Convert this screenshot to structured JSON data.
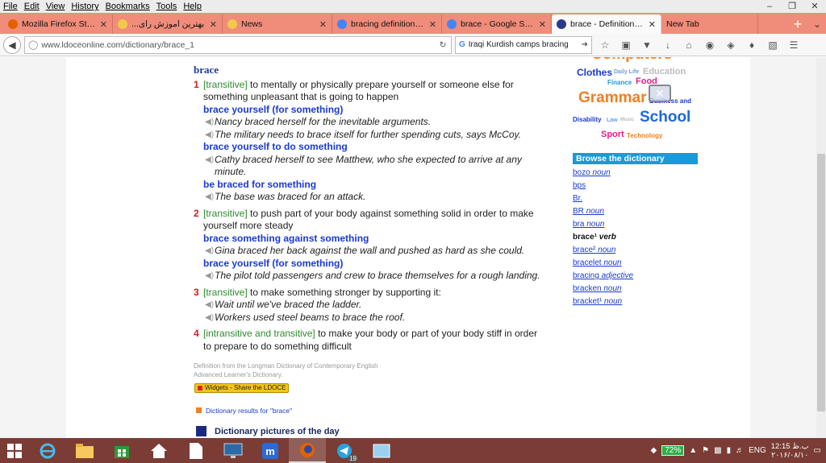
{
  "menu": [
    "File",
    "Edit",
    "View",
    "History",
    "Bookmarks",
    "Tools",
    "Help"
  ],
  "tabs": [
    {
      "label": "Mozilla Firefox Start P...",
      "icon_color": "#e66000",
      "active": false
    },
    {
      "label": "...بهترین آموزش رای",
      "icon_color": "#f2c94c",
      "active": false
    },
    {
      "label": "News",
      "icon_color": "#f2c94c",
      "active": false
    },
    {
      "label": "bracing definition - G...",
      "icon_color": "#4285f4",
      "active": false
    },
    {
      "label": "brace - Google Search",
      "icon_color": "#4285f4",
      "active": false
    },
    {
      "label": "brace - Definition fro...",
      "icon_color": "#2a3a8a",
      "active": true
    },
    {
      "label": "New Tab",
      "icon_color": "",
      "active": false
    }
  ],
  "nav": {
    "url": "www.ldoceonline.com/dictionary/brace_1",
    "search_value": "Iraqi Kurdish camps bracing"
  },
  "entry": {
    "headword": "brace",
    "senses": [
      {
        "num": "1",
        "gram": "[transitive]",
        "def": " to mentally or physically prepare yourself or someone else for something unpleasant that is going to happen",
        "items": [
          {
            "type": "phrase",
            "text": "brace yourself (for something)"
          },
          {
            "type": "example",
            "text": "Nancy braced herself for the inevitable arguments."
          },
          {
            "type": "example",
            "text": "The military needs to brace itself for further spending cuts, says McCoy."
          },
          {
            "type": "phrase",
            "text": "brace yourself to do something"
          },
          {
            "type": "example",
            "text": "Cathy braced herself to see Matthew, who she expected to arrive at any minute."
          },
          {
            "type": "phrase",
            "text": "be braced for something"
          },
          {
            "type": "example",
            "text": "The base was braced for an attack."
          }
        ]
      },
      {
        "num": "2",
        "gram": "[transitive]",
        "def": " to push part of your body against something solid in order to make yourself more steady",
        "items": [
          {
            "type": "phrase",
            "text": "brace something against something"
          },
          {
            "type": "example",
            "text": "Gina braced her back against the wall and pushed as hard as she could."
          },
          {
            "type": "phrase",
            "text": "brace yourself (for something)"
          },
          {
            "type": "example",
            "text": "The pilot told passengers and crew to brace themselves for a rough landing."
          }
        ]
      },
      {
        "num": "3",
        "gram": "[transitive]",
        "def": " to make something stronger by supporting it:",
        "items": [
          {
            "type": "example",
            "text": "Wait until we've braced the ladder."
          },
          {
            "type": "example",
            "text": "Workers used steel beams to brace the roof."
          }
        ]
      },
      {
        "num": "4",
        "gram": "[intransitive and transitive]",
        "def": " to make your body or part of your body stiff in order to prepare to do something difficult",
        "items": []
      }
    ]
  },
  "footer": {
    "attribution_1": "Definition from the Longman Dictionary of Contemporary English",
    "attribution_2": "Advanced Learner's Dictionary.",
    "widgets_label": "Widgets - Share the LDOCE",
    "results_label": "Dictionary results for \"brace\"",
    "pictures_title": "Dictionary pictures of the day"
  },
  "topic_cloud": [
    {
      "text": "Computers",
      "color": "#f08020"
    },
    {
      "text": "Clothes",
      "color": "#1a3ad0"
    },
    {
      "text": "Daily Life",
      "color": "#6aa0e0"
    },
    {
      "text": "Education",
      "color": "#bbbbbb"
    },
    {
      "text": "Finance",
      "color": "#1a9ad8"
    },
    {
      "text": "Food",
      "color": "#e0208a"
    },
    {
      "text": "Grammar",
      "color": "#f08020"
    },
    {
      "text": "Business and",
      "color": "#1a3ad0"
    },
    {
      "text": "Disability",
      "color": "#1a3ad0"
    },
    {
      "text": "Law",
      "color": "#6aa0e0"
    },
    {
      "text": "Music",
      "color": "#bbbbbb"
    },
    {
      "text": "School",
      "color": "#1a6ad8"
    },
    {
      "text": "Sport",
      "color": "#e0208a"
    },
    {
      "text": "Technology",
      "color": "#f08020"
    }
  ],
  "browse": {
    "title": "Browse the dictionary",
    "items": [
      {
        "word": "bozo",
        "pos": "noun",
        "current": false
      },
      {
        "word": "bps",
        "pos": "",
        "current": false
      },
      {
        "word": "Br.",
        "pos": "",
        "current": false
      },
      {
        "word": "BR",
        "pos": "noun",
        "current": false
      },
      {
        "word": "bra",
        "pos": "noun",
        "current": false
      },
      {
        "word": "brace¹",
        "pos": "verb",
        "current": true
      },
      {
        "word": "brace²",
        "pos": "noun",
        "current": false
      },
      {
        "word": "bracelet",
        "pos": "noun",
        "current": false
      },
      {
        "word": "bracing",
        "pos": "adjective",
        "current": false
      },
      {
        "word": "bracken",
        "pos": "noun",
        "current": false
      },
      {
        "word": "bracket¹",
        "pos": "noun",
        "current": false
      }
    ]
  },
  "taskbar": {
    "battery": "72%",
    "lang": "ENG",
    "time": "12:15 ب.ظ",
    "date": "۲۰۱۶/۰۸/۱۰",
    "telegram_badge": "19"
  }
}
